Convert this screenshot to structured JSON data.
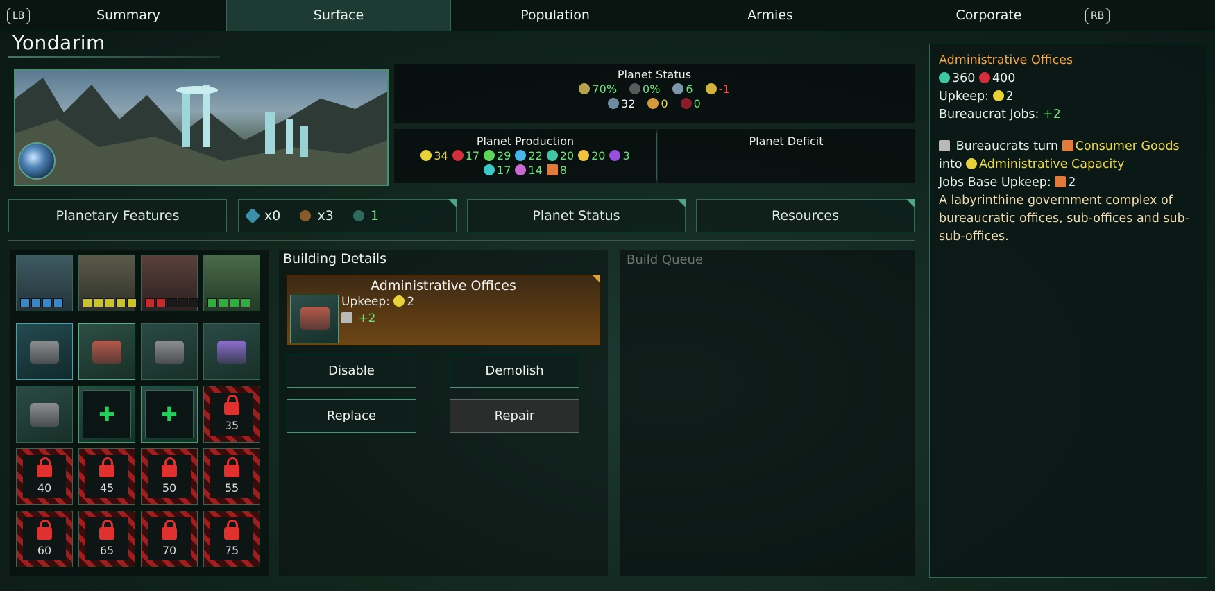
{
  "tabs": {
    "lb": "LB",
    "rb": "RB",
    "items": [
      "Summary",
      "Surface",
      "Population",
      "Armies",
      "Corporate"
    ]
  },
  "planet": {
    "name": "Yondarim"
  },
  "planet_status": {
    "title": "Planet Status",
    "stability": "70%",
    "crime": "0%",
    "amenities": "6",
    "happiness_mod": "-1",
    "pops": "32",
    "unemployed": "0",
    "deviancy": "0"
  },
  "production": {
    "title": "Planet Production",
    "energy": "34",
    "minerals": "17",
    "food": "29",
    "research": "22",
    "unity": "20",
    "alloys": "20",
    "influence": "3",
    "trade": "17",
    "consumer_goods": "14",
    "jobs": "8"
  },
  "deficit": {
    "title": "Planet Deficit"
  },
  "bar": {
    "features": "Planetary Features",
    "slot_a": "x0",
    "slot_b": "x3",
    "slot_c": "1",
    "status": "Planet Status",
    "resources": "Resources"
  },
  "grid": {
    "locked_levels": [
      "35",
      "40",
      "45",
      "50",
      "55",
      "60",
      "65",
      "70",
      "75"
    ]
  },
  "details": {
    "title": "Building Details",
    "building_name": "Administrative Offices",
    "upkeep_label": "Upkeep:",
    "upkeep_value": "2",
    "jobs_value": "+2",
    "disable": "Disable",
    "demolish": "Demolish",
    "replace": "Replace",
    "repair": "Repair"
  },
  "queue": {
    "title": "Build Queue"
  },
  "tooltip": {
    "name": "Administrative Offices",
    "cost_alloys": "360",
    "cost_minerals": "400",
    "upkeep_label": "Upkeep:",
    "upkeep_value": "2",
    "jobs_label": "Bureaucrat Jobs:",
    "jobs_value": "+2",
    "desc_a": "Bureaucrats turn",
    "desc_b": "Consumer Goods",
    "desc_c": "into",
    "desc_d": "Administrative Capacity",
    "base_upkeep_label": "Jobs Base Upkeep:",
    "base_upkeep_value": "2",
    "flavor": "A labyrinthine government complex of bureaucratic offices, sub-offices and sub-sub-offices."
  },
  "colors": {
    "accent": "#2f6a57",
    "orange_title": "#f4a84a",
    "yellow_key": "#ecd84f",
    "good": "#6fe17a",
    "bad": "#ff4b4b"
  }
}
